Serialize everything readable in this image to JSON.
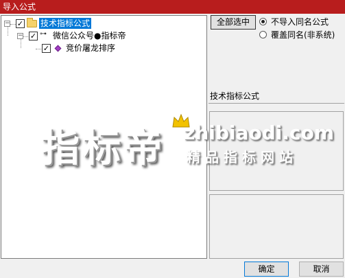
{
  "window": {
    "title": "导入公式"
  },
  "tree": {
    "root": {
      "label": "技术指标公式",
      "checked": true,
      "expander": "−"
    },
    "child": {
      "label": "微信公众号●指标帝",
      "checked": true,
      "expander": "−"
    },
    "leaf": {
      "label": "竞价屠龙排序",
      "checked": true
    }
  },
  "right": {
    "select_all_label": "全部选中",
    "radio_options": [
      {
        "label": "不导入同名公式",
        "selected": true
      },
      {
        "label": "覆盖同名(非系统)",
        "selected": false
      }
    ],
    "formula_type": "技术指标公式"
  },
  "buttons": {
    "ok_label": "确定",
    "cancel_label": "取消"
  },
  "watermark": {
    "big": "指标帝",
    "url": "zhibiaodi.com",
    "sub": "精品指标网站"
  },
  "colors": {
    "titlebar": "#b81d1d",
    "selection": "#0078d7",
    "crown": "#f2c200"
  },
  "icons": {
    "root": "folder-icon",
    "child": "key-icon",
    "leaf": "formula-diamond-icon",
    "watermark": "crown-icon"
  }
}
